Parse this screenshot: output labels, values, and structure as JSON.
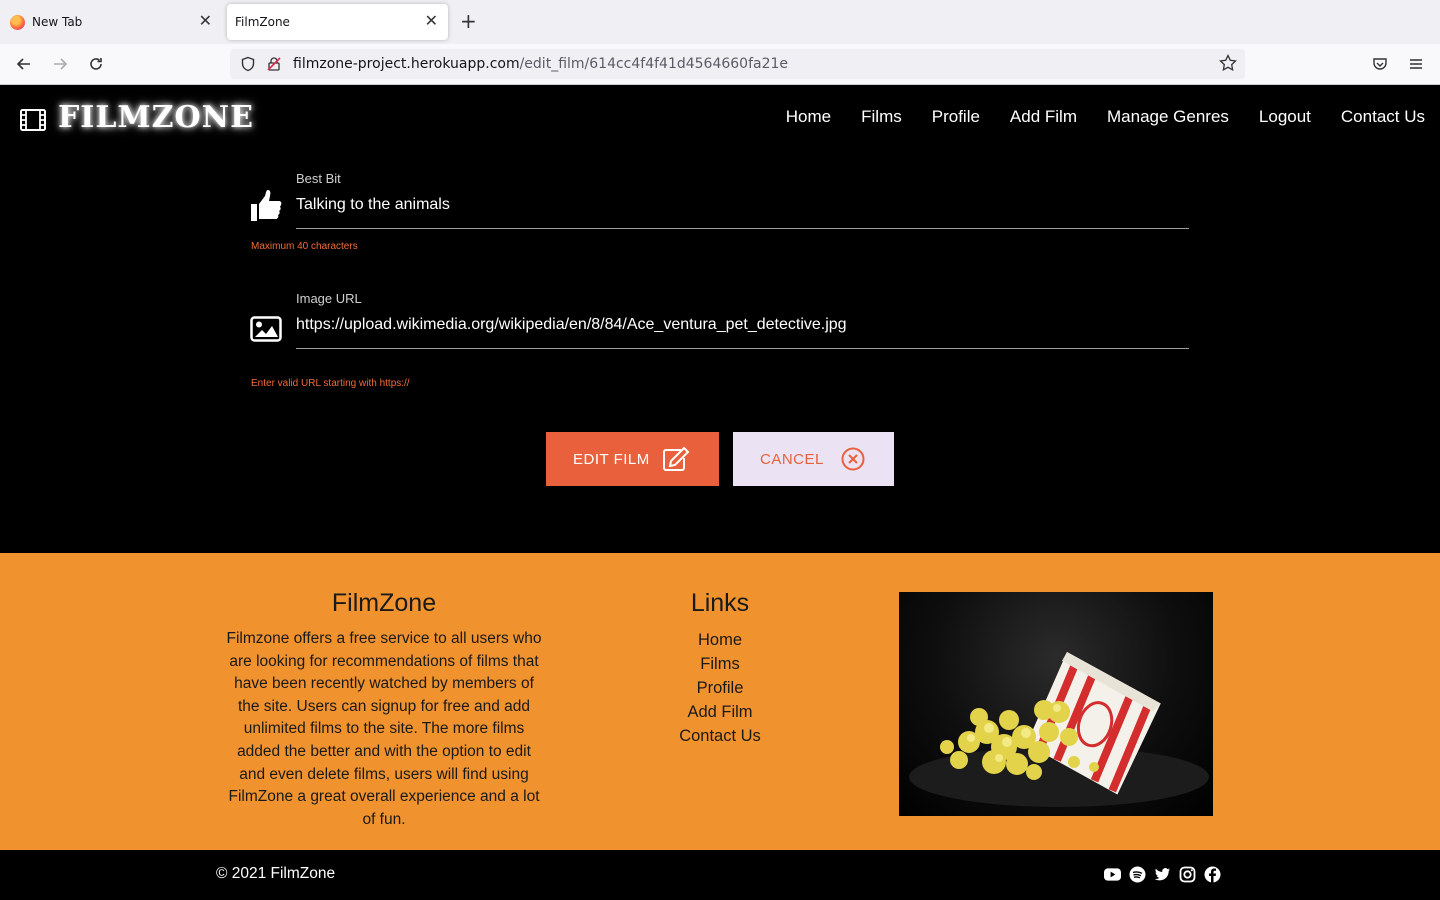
{
  "browser": {
    "tabs": [
      {
        "title": "New Tab"
      },
      {
        "title": "FilmZone"
      }
    ],
    "url_host": "filmzone-project.herokuapp.com",
    "url_path": "/edit_film/614cc4f4f41d4564660fa21e"
  },
  "header": {
    "brand": "FILMZONE",
    "nav": [
      "Home",
      "Films",
      "Profile",
      "Add Film",
      "Manage Genres",
      "Logout",
      "Contact Us"
    ]
  },
  "form": {
    "best_bit": {
      "label": "Best Bit",
      "value": "Talking to the animals",
      "helper": "Maximum 40 characters",
      "icon": "thumbs-up-icon"
    },
    "image_url": {
      "label": "Image URL",
      "value": "https://upload.wikimedia.org/wikipedia/en/8/84/Ace_ventura_pet_detective.jpg",
      "helper": "Enter valid URL starting with https://",
      "icon": "image-icon"
    },
    "edit_button": "EDIT FILM",
    "cancel_button": "CANCEL"
  },
  "footer": {
    "about_title": "FilmZone",
    "about_text": "Filmzone offers a free service to all users who are looking for recommendations of films that have been recently watched by members of the site. Users can signup for free and add unlimited films to the site. The more films added the better and with the option to edit and even delete films, users will find using FilmZone a great overall experience and a lot of fun.",
    "links_title": "Links",
    "links": [
      "Home",
      "Films",
      "Profile",
      "Add Film",
      "Contact Us"
    ],
    "copyright": "© 2021 FilmZone",
    "socials": [
      "youtube-icon",
      "spotify-icon",
      "twitter-icon",
      "instagram-icon",
      "facebook-icon"
    ]
  },
  "colors": {
    "accent": "#e8603c",
    "footer_bg": "#f0922e",
    "cancel_bg": "#ebe3f3"
  }
}
